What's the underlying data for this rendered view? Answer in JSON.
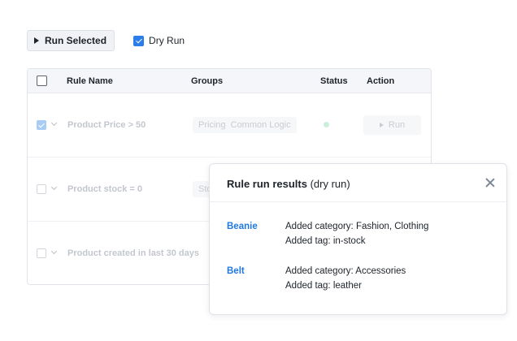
{
  "toolbar": {
    "run_selected_label": "Run Selected",
    "dry_run_label": "Dry Run",
    "dry_run_checked": true
  },
  "table": {
    "columns": {
      "rule_name": "Rule Name",
      "groups": "Groups",
      "status": "Status",
      "action": "Action"
    },
    "rows": [
      {
        "name": "Product Price > 50",
        "groups": [
          "Pricing",
          "Common Logic"
        ],
        "checked": true,
        "run_label": "Run"
      },
      {
        "name": "Product stock = 0",
        "groups": [
          "Sto"
        ],
        "checked": false
      },
      {
        "name": "Product created in last 30 days",
        "groups": [],
        "checked": false
      }
    ]
  },
  "popup": {
    "title_bold": "Rule run results",
    "title_suffix": " (dry run)",
    "results": [
      {
        "product": "Beanie",
        "lines": [
          "Added category: Fashion, Clothing",
          "Added tag: in-stock"
        ]
      },
      {
        "product": "Belt",
        "lines": [
          "Added category: Accessories",
          "Added tag: leather"
        ]
      }
    ]
  },
  "colors": {
    "accent": "#2b7de9",
    "link": "#1f77e0",
    "status_active": "#c9f0d9"
  }
}
